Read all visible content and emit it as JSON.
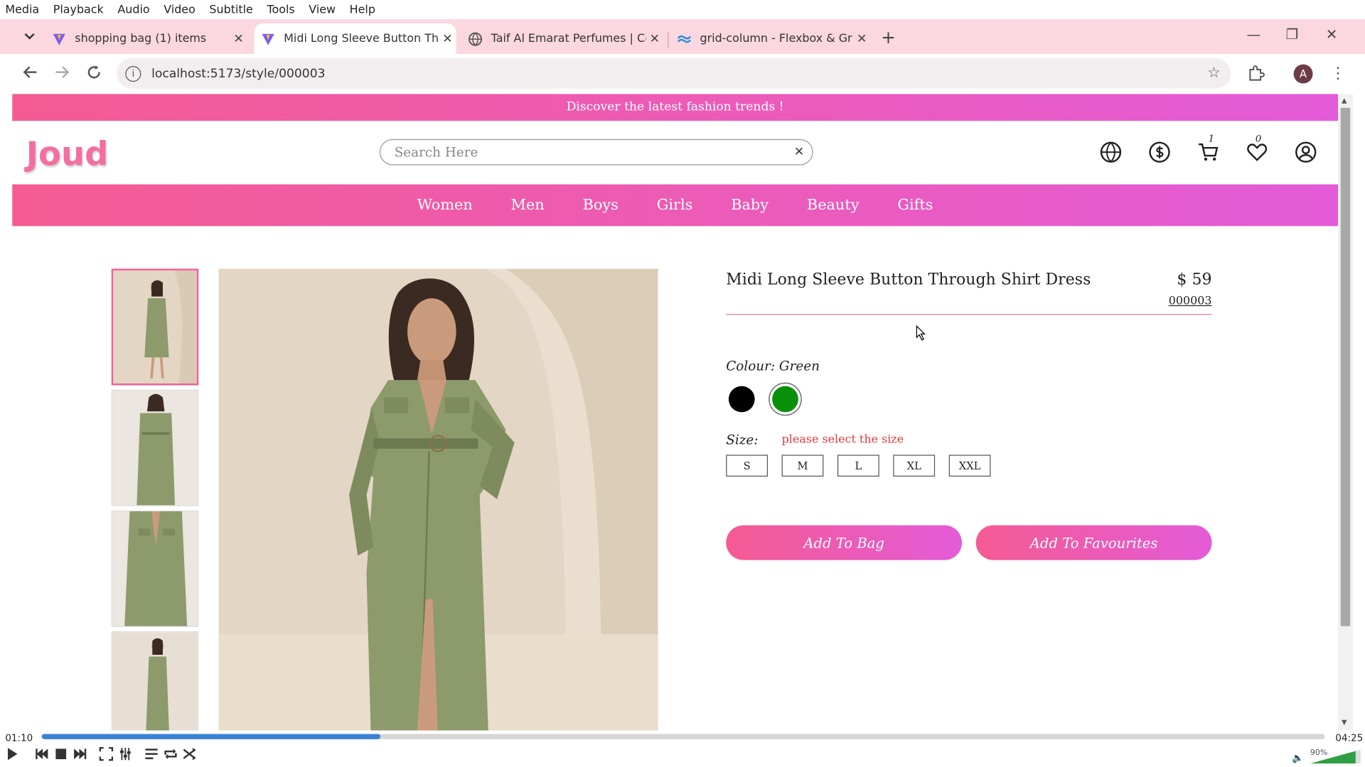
{
  "vlc": {
    "menu": [
      "Media",
      "Playback",
      "Audio",
      "Video",
      "Subtitle",
      "Tools",
      "View",
      "Help"
    ],
    "time_elapsed": "01:10",
    "time_total": "04:25",
    "progress": 0.264,
    "volume_label": "90%",
    "volume": 0.9
  },
  "browser": {
    "tabs": [
      {
        "title": "shopping bag (1) items"
      },
      {
        "title": "Midi Long Sleeve Button Throu"
      },
      {
        "title": "Taif Al Emarat Perfumes | Conti"
      },
      {
        "title": "grid-column - Flexbox & Grid -"
      }
    ],
    "url": "localhost:5173/style/000003",
    "profile_initial": "A"
  },
  "site": {
    "announcement": "Discover the latest fashion trends !",
    "logo": "Joud",
    "search_placeholder": "Search Here",
    "cart_count": "1",
    "fav_count": "0",
    "categories": [
      "Women",
      "Men",
      "Boys",
      "Girls",
      "Baby",
      "Beauty",
      "Gifts"
    ]
  },
  "product": {
    "title": "Midi Long Sleeve Button Through Shirt Dress",
    "price": "$ 59",
    "sku": "000003",
    "colour_label": "Colour: Green",
    "colours": [
      {
        "name": "Black",
        "hex": "#000000"
      },
      {
        "name": "Green",
        "hex": "#0a8f0a"
      }
    ],
    "selected_colour": "Green",
    "size_label": "Size:",
    "size_error": "please select the size",
    "sizes": [
      "S",
      "M",
      "L",
      "XL",
      "XXL"
    ],
    "add_to_bag": "Add To Bag",
    "add_to_fav": "Add To Favourites"
  },
  "colors": {
    "brand_pink": "#f55b92",
    "brand_magenta": "#e35bd8",
    "dress_olive": "#8d9a6c",
    "backdrop": "#e3d6c4"
  }
}
